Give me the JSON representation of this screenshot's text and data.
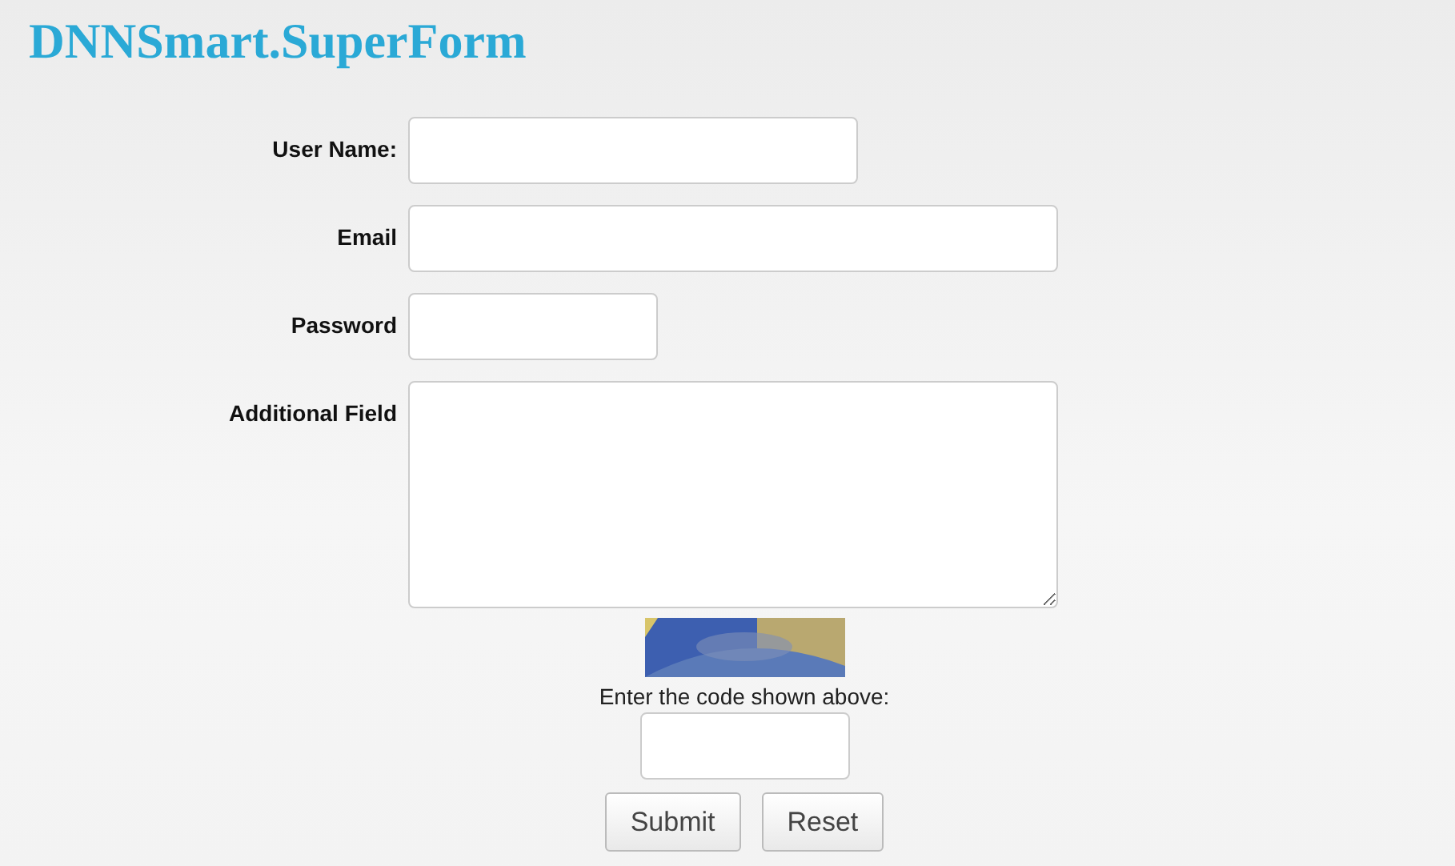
{
  "title": "DNNSmart.SuperForm",
  "fields": [
    {
      "label": "User Name:",
      "kind": "text"
    },
    {
      "label": "Email",
      "kind": "email"
    },
    {
      "label": "Password",
      "kind": "password"
    },
    {
      "label": "Additional Field",
      "kind": "textarea"
    }
  ],
  "captcha": {
    "kind": "picture",
    "prompt": "Enter the code shown above:"
  },
  "buttons": [
    "Submit",
    "Reset"
  ]
}
